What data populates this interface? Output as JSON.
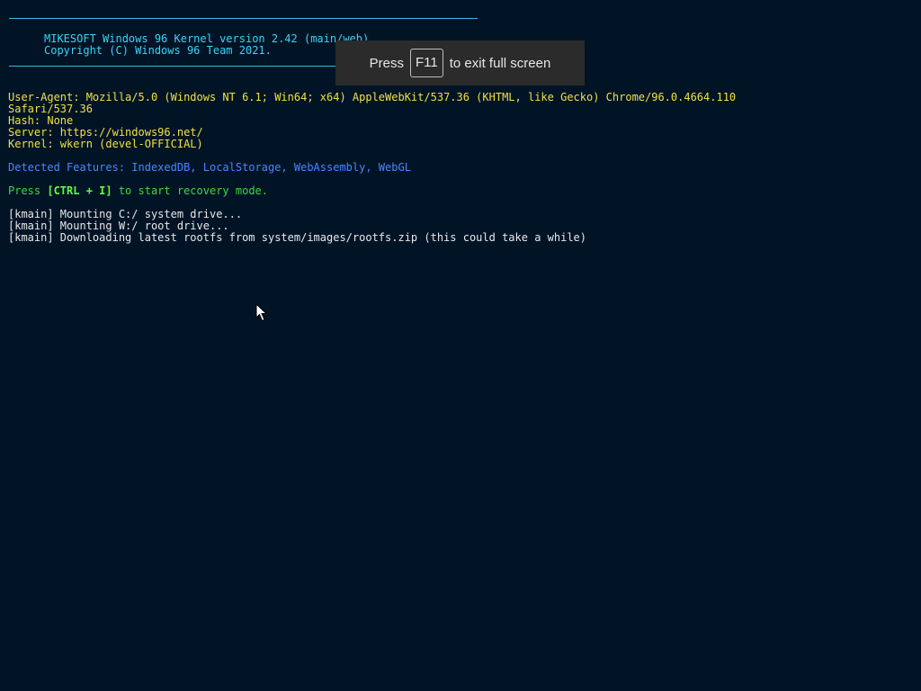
{
  "banner": {
    "title_line": "MIKESOFT Windows 96 Kernel version 2.42 (main/web).",
    "copyright_line": "Copyright (C) Windows 96 Team 2021."
  },
  "info": {
    "user_agent_line1": "User-Agent: Mozilla/5.0 (Windows NT 6.1; Win64; x64) AppleWebKit/537.36 (KHTML, like Gecko) Chrome/96.0.4664.110",
    "user_agent_line2": "Safari/537.36",
    "hash": "Hash: None",
    "server": "Server: https://windows96.net/",
    "kernel": "Kernel: wkern (devel-OFFICIAL)"
  },
  "features": {
    "text": "Detected Features: IndexedDB, LocalStorage, WebAssembly, WebGL"
  },
  "recovery": {
    "prefix": "Press ",
    "keys": "[CTRL + I]",
    "suffix": " to start recovery mode."
  },
  "log": [
    "[kmain] Mounting C:/ system drive...",
    "[kmain] Mounting W:/ root drive...",
    "[kmain] Downloading latest rootfs from system/images/rootfs.zip (this could take a while)"
  ],
  "fullscreen_toast": {
    "prefix": "Press",
    "key": "F11",
    "suffix": "to exit full screen"
  },
  "colors": {
    "background": "#011426",
    "banner": "#3dd3f5",
    "info": "#f0e040",
    "features": "#4a86ff",
    "recovery": "#40d840",
    "log": "#e8e8e8"
  },
  "icons": {
    "pointer": "mouse-pointer-icon"
  }
}
